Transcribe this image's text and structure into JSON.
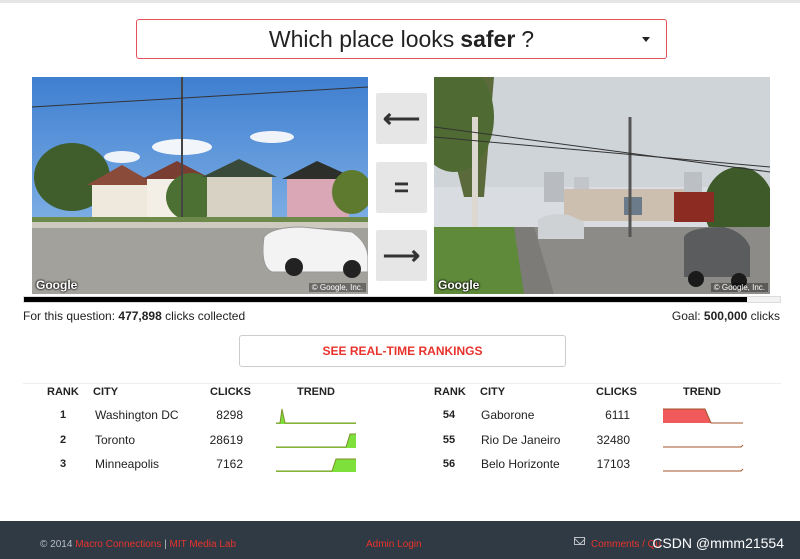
{
  "question": {
    "prefix": "Which place looks",
    "keyword": "safer",
    "suffix": "?"
  },
  "images": {
    "left": {
      "brand": "Google",
      "copyright": "© Google, Inc."
    },
    "right": {
      "brand": "Google",
      "copyright": "© Google, Inc."
    }
  },
  "vote": {
    "left_symbol": "⟵",
    "equal_symbol": "=",
    "right_symbol": "⟶"
  },
  "progress": {
    "label": "For this question:",
    "collected": "477,898",
    "collected_suffix": "clicks collected",
    "goal_label": "Goal:",
    "goal": "500,000",
    "goal_suffix": "clicks",
    "fraction": 0.956
  },
  "rankings_button": "SEE REAL-TIME RANKINGS",
  "table_headers": {
    "rank": "RANK",
    "city": "CITY",
    "clicks": "CLICKS",
    "trend": "TREND"
  },
  "left_table": [
    {
      "rank": "1",
      "city": "Washington DC",
      "clicks": "8298",
      "trend": "spike-start"
    },
    {
      "rank": "2",
      "city": "Toronto",
      "clicks": "28619",
      "trend": "rise-end"
    },
    {
      "rank": "3",
      "city": "Minneapolis",
      "clicks": "7162",
      "trend": "plateau-end"
    }
  ],
  "right_table": [
    {
      "rank": "54",
      "city": "Gaborone",
      "clicks": "6111",
      "trend": "high-start"
    },
    {
      "rank": "55",
      "city": "Rio De Janeiro",
      "clicks": "32480",
      "trend": "flat"
    },
    {
      "rank": "56",
      "city": "Belo Horizonte",
      "clicks": "17103",
      "trend": "flat"
    }
  ],
  "colors": {
    "accent": "#e8332d",
    "trend_up": "#7ee03a",
    "trend_down": "#f15a5a",
    "footer_bg": "#2f3a45"
  },
  "footer": {
    "copyright": "© 2014",
    "org1": "Macro Connections",
    "sep": "|",
    "org2": "MIT Media Lab",
    "admin": "Admin Login",
    "comments": "Comments / Qu",
    "watermark": "CSDN @mmm21554"
  }
}
